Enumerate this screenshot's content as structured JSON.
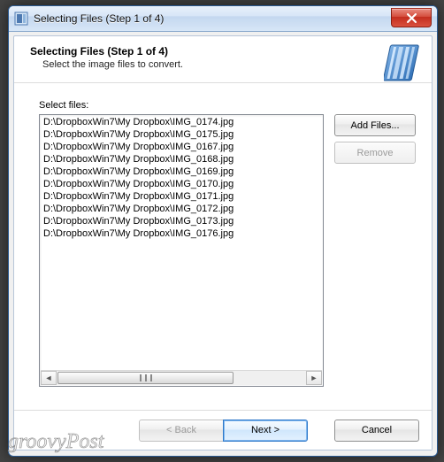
{
  "window": {
    "title": "Selecting Files (Step 1 of 4)"
  },
  "header": {
    "title": "Selecting Files (Step 1 of 4)",
    "subtitle": "Select the image files to convert."
  },
  "labels": {
    "select_files": "Select files:"
  },
  "files": [
    "D:\\DropboxWin7\\My Dropbox\\IMG_0174.jpg",
    "D:\\DropboxWin7\\My Dropbox\\IMG_0175.jpg",
    "D:\\DropboxWin7\\My Dropbox\\IMG_0167.jpg",
    "D:\\DropboxWin7\\My Dropbox\\IMG_0168.jpg",
    "D:\\DropboxWin7\\My Dropbox\\IMG_0169.jpg",
    "D:\\DropboxWin7\\My Dropbox\\IMG_0170.jpg",
    "D:\\DropboxWin7\\My Dropbox\\IMG_0171.jpg",
    "D:\\DropboxWin7\\My Dropbox\\IMG_0172.jpg",
    "D:\\DropboxWin7\\My Dropbox\\IMG_0173.jpg",
    "D:\\DropboxWin7\\My Dropbox\\IMG_0176.jpg"
  ],
  "buttons": {
    "add_files": "Add Files...",
    "remove": "Remove",
    "back": "< Back",
    "next": "Next >",
    "cancel": "Cancel"
  },
  "state": {
    "remove_enabled": false,
    "back_enabled": false
  },
  "watermark": "groovyPost"
}
